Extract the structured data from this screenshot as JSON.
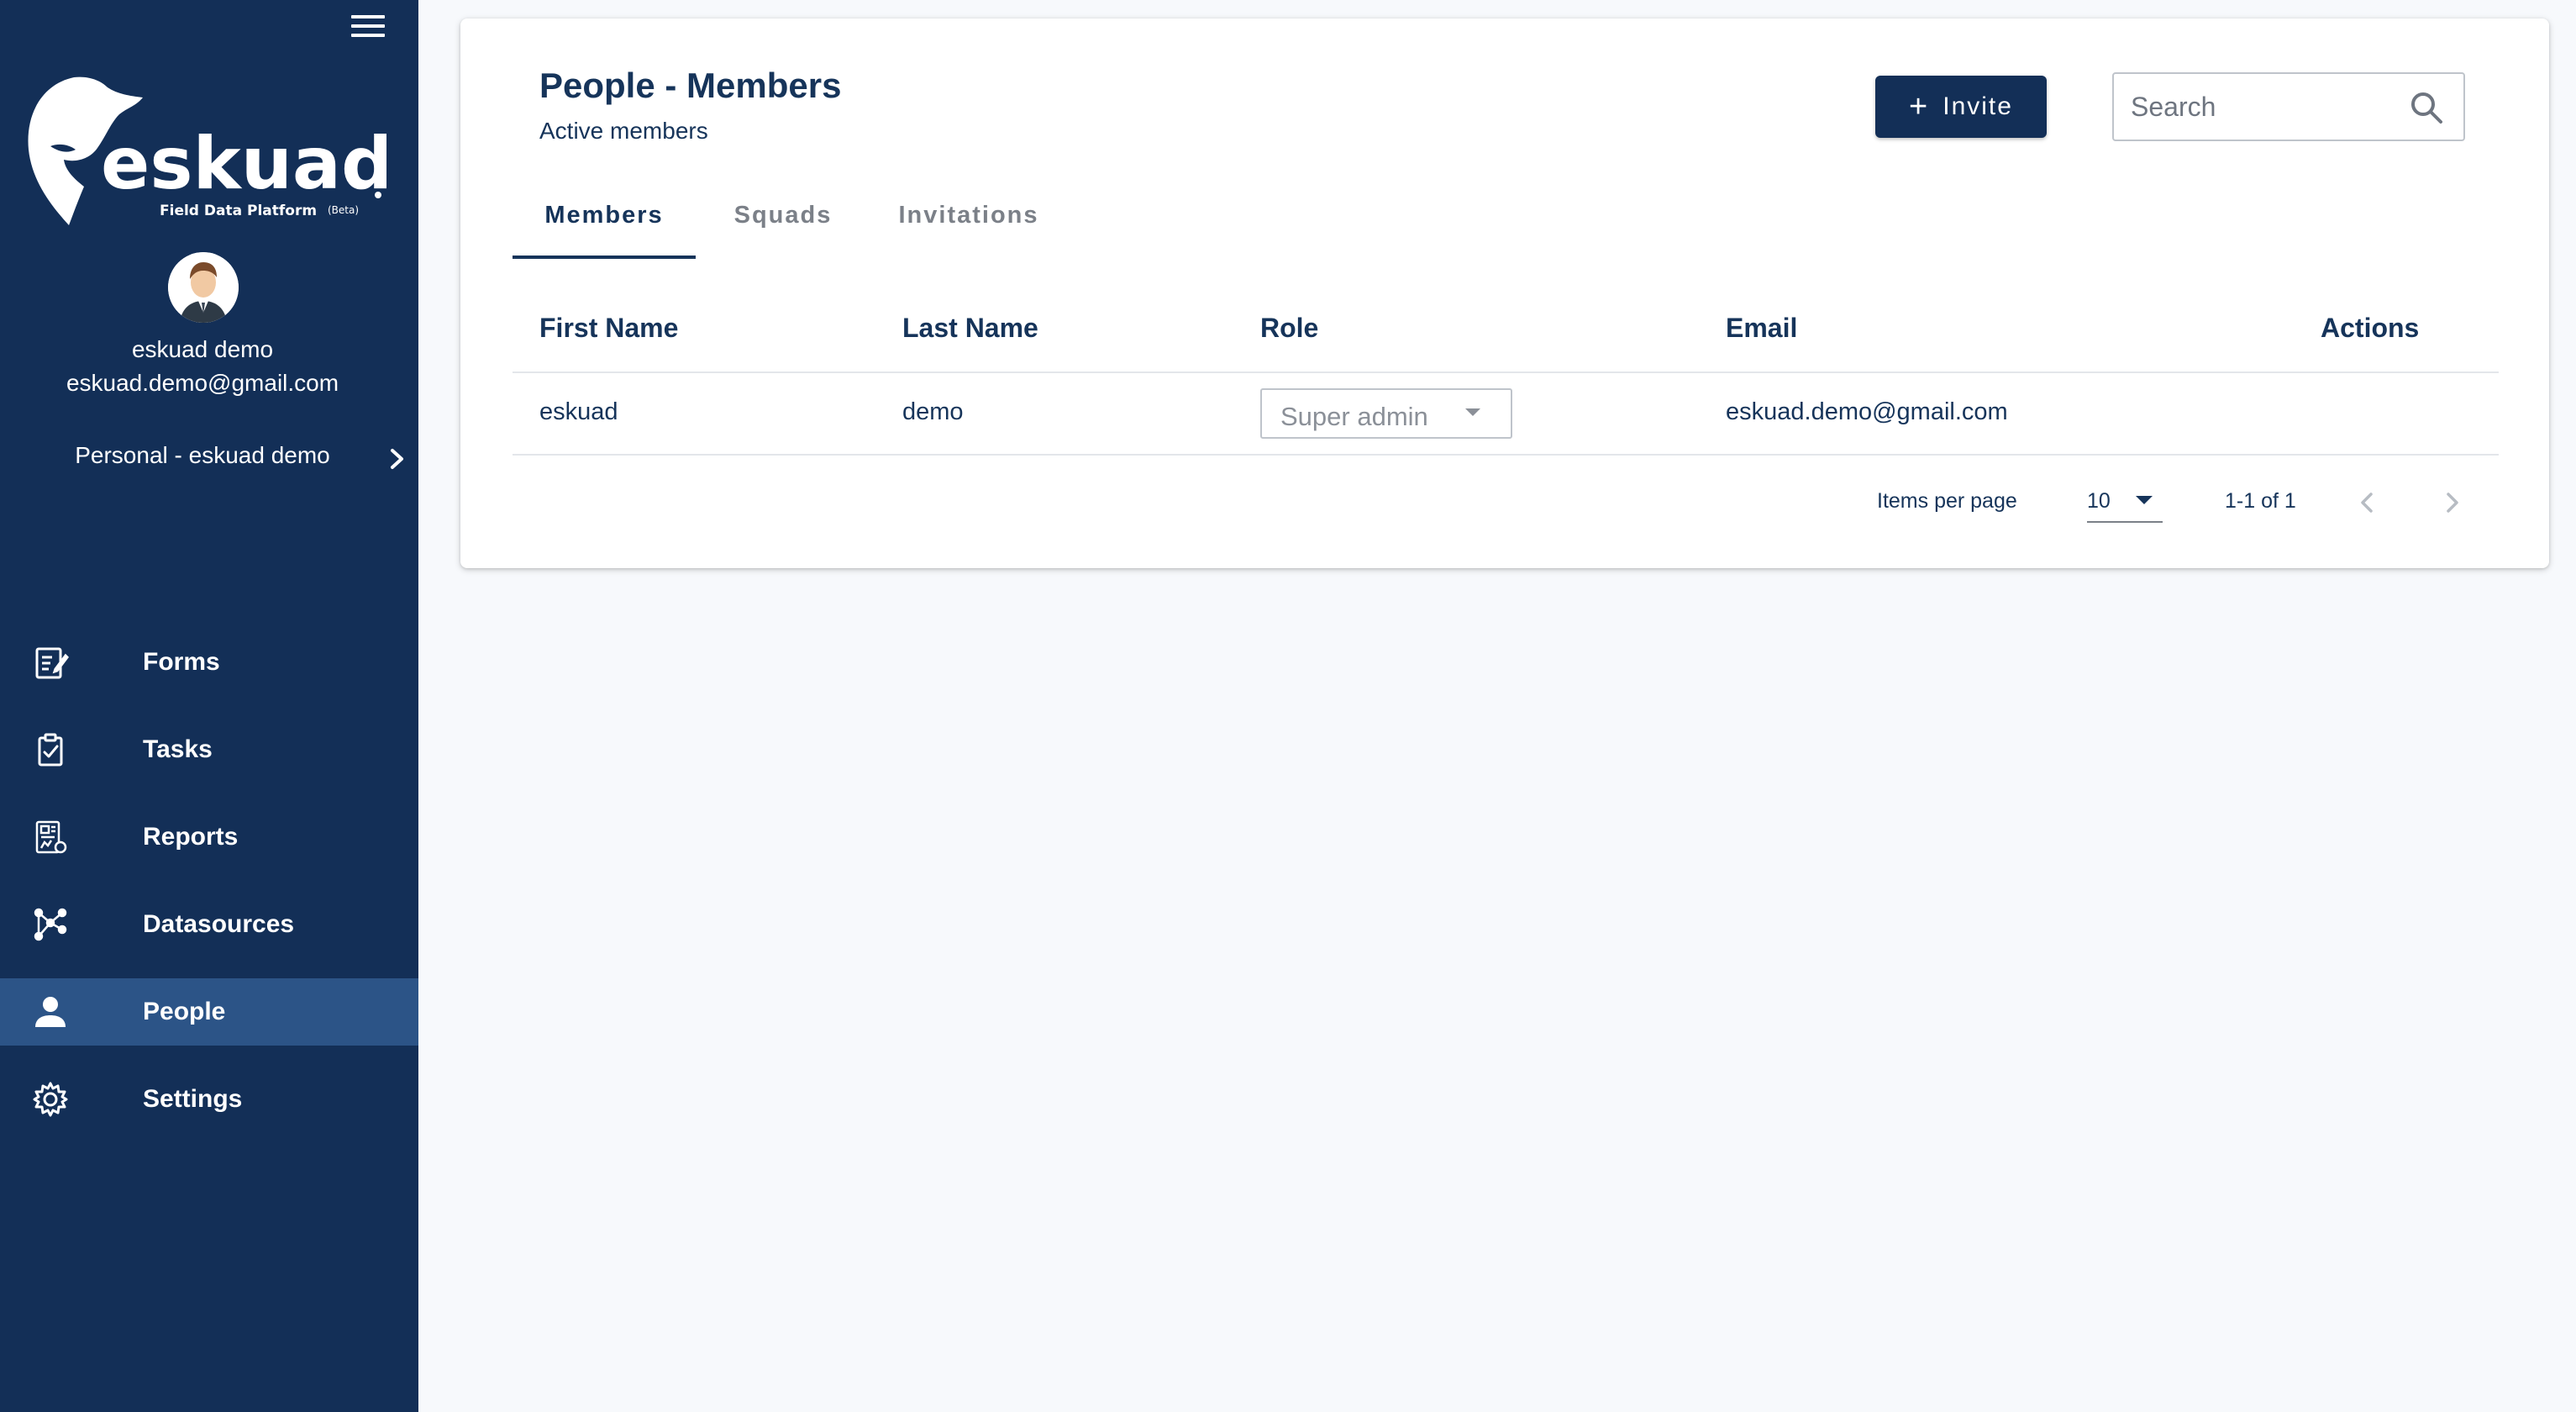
{
  "sidebar": {
    "logo_text": "eskuad",
    "logo_tagline": "Field Data Platform",
    "logo_beta": "(Beta)",
    "user_name": "eskuad demo",
    "user_email": "eskuad.demo@gmail.com",
    "workspace": "Personal - eskuad demo",
    "nav": [
      {
        "label": "Forms",
        "icon": "forms-icon"
      },
      {
        "label": "Tasks",
        "icon": "tasks-icon"
      },
      {
        "label": "Reports",
        "icon": "reports-icon"
      },
      {
        "label": "Datasources",
        "icon": "datasources-icon"
      },
      {
        "label": "People",
        "icon": "person-icon",
        "active": true
      },
      {
        "label": "Settings",
        "icon": "gear-icon"
      }
    ]
  },
  "header": {
    "title": "People - Members",
    "subtitle": "Active members",
    "invite_label": "Invite",
    "invite_icon": "plus-icon",
    "search_placeholder": "Search"
  },
  "tabs": [
    {
      "label": "Members",
      "active": true
    },
    {
      "label": "Squads"
    },
    {
      "label": "Invitations"
    }
  ],
  "table": {
    "columns": [
      "First Name",
      "Last Name",
      "Role",
      "Email",
      "Actions"
    ],
    "rows": [
      {
        "first_name": "eskuad",
        "last_name": "demo",
        "role": "Super admin",
        "email": "eskuad.demo@gmail.com"
      }
    ]
  },
  "paginator": {
    "items_per_page_label": "Items per page",
    "items_per_page": "10",
    "range": "1-1 of 1"
  },
  "colors": {
    "sidebar": "#132f57",
    "active_nav": "#2c5487",
    "primary": "#16345a",
    "background": "#f7f9fc"
  }
}
